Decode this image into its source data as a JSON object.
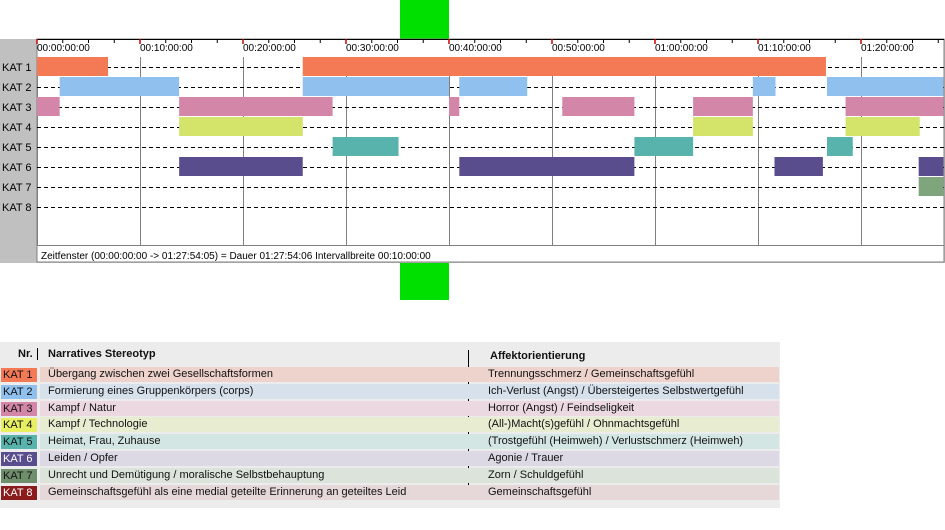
{
  "chart_data": {
    "type": "timeline",
    "time_unit": "minutes",
    "x_range": [
      0,
      88
    ],
    "ticks": [
      "00:00:00:00",
      "00:10:00:00",
      "00:20:00:00",
      "00:30:00:00",
      "00:40:00:00",
      "00:50:00:00",
      "01:00:00:00",
      "01:10:00:00",
      "01:20:00:00"
    ],
    "categories": [
      {
        "label": "KAT 1",
        "color": "#f47a55",
        "intervals": [
          [
            0,
            6.9
          ],
          [
            25.8,
            76.6
          ]
        ]
      },
      {
        "label": "KAT 2",
        "color": "#90c0ee",
        "intervals": [
          [
            2.2,
            13.8
          ],
          [
            25.8,
            40.0
          ],
          [
            41.0,
            47.6
          ],
          [
            69.5,
            71.7
          ],
          [
            76.7,
            88.0
          ]
        ]
      },
      {
        "label": "KAT 3",
        "color": "#d486a8",
        "intervals": [
          [
            0,
            2.2
          ],
          [
            13.8,
            28.7
          ],
          [
            40.0,
            41.0
          ],
          [
            51.0,
            58.0
          ],
          [
            63.7,
            69.5
          ],
          [
            78.5,
            88.0
          ]
        ]
      },
      {
        "label": "KAT 4",
        "color": "#d4e36a",
        "intervals": [
          [
            13.8,
            25.8
          ],
          [
            63.7,
            69.5
          ],
          [
            78.5,
            85.7
          ]
        ]
      },
      {
        "label": "KAT 5",
        "color": "#57b3ab",
        "intervals": [
          [
            28.7,
            35.1
          ],
          [
            58.0,
            63.7
          ],
          [
            76.7,
            79.2
          ]
        ]
      },
      {
        "label": "KAT 6",
        "color": "#5a4d8e",
        "intervals": [
          [
            13.8,
            25.8
          ],
          [
            41.0,
            58.0
          ],
          [
            71.6,
            76.3
          ],
          [
            85.6,
            88.0
          ]
        ]
      },
      {
        "label": "KAT 7",
        "color": "#7ea57c",
        "intervals": [
          [
            85.6,
            88.0
          ]
        ]
      },
      {
        "label": "KAT 8",
        "color": "#8b1c1c",
        "intervals": []
      }
    ],
    "status_text": "Zeitfenster (00:00:00:00 -> 01:27:54:05) = Dauer 01:27:54:06    Intervallbreite 00:10:00:00"
  },
  "legend": {
    "col_nr": "Nr.",
    "col_stereotyp": "Narratives Stereotyp",
    "col_affekt": "Affektorientierung",
    "rows": [
      {
        "kat": "KAT 1",
        "badge": "#f47a55",
        "band": "#eed3cc",
        "stereotyp": "Übergang zwischen zwei Gesellschaftsformen",
        "affekt": "Trennungsschmerz / Gemeinschaftsgefühl"
      },
      {
        "kat": "KAT 2",
        "badge": "#90c0ee",
        "band": "#d6e1ec",
        "stereotyp": "Formierung eines Gruppenkörpers (corps)",
        "affekt": "Ich-Verlust (Angst) / Übersteigertes Selbstwertgefühl"
      },
      {
        "kat": "KAT 3",
        "badge": "#d486a8",
        "band": "#ecd8e0",
        "stereotyp": "Kampf / Natur",
        "affekt": "Horror (Angst) / Feindseligkeit"
      },
      {
        "kat": "KAT 4",
        "badge": "#e8f060",
        "band": "#e8ecd0",
        "stereotyp": "Kampf / Technologie",
        "affekt": "(All-)Macht(s)gefühl / Ohnmachtsgefühl"
      },
      {
        "kat": "KAT 5",
        "badge": "#57b3ab",
        "band": "#d3e6e3",
        "stereotyp": "Heimat, Frau, Zuhause",
        "affekt": "(Trostgefühl (Heimweh) / Verlustschmerz (Heimweh)"
      },
      {
        "kat": "KAT 6",
        "badge": "#5a4d8e",
        "band": "#dcd9e5",
        "stereotyp": "Leiden / Opfer",
        "affekt": "Agonie / Trauer"
      },
      {
        "kat": "KAT 7",
        "badge": "#6f8f6c",
        "band": "#dbe3da",
        "stereotyp": "Unrecht und Demütigung / moralische Selbstbehauptung",
        "affekt": "Zorn / Schuldgefühl"
      },
      {
        "kat": "KAT 8",
        "badge": "#8b1c1c",
        "band": "#e6d8d8",
        "stereotyp": "Gemeinschaftsgefühl als eine medial geteilte Erinnerung an geteiltes Leid",
        "affekt": "Gemeinschaftsgefühl"
      }
    ]
  }
}
